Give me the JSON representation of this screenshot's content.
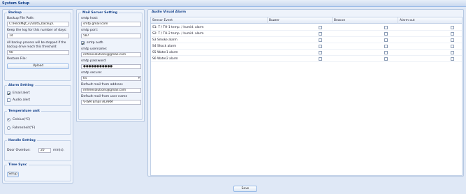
{
  "window": {
    "title": "System Setup"
  },
  "backup": {
    "legend": "Backup",
    "file_path_label": "Backup File Path:",
    "file_path_value": "C:\\ReckMgt_v2\\data_backup\\",
    "keep_log_label": "Keep the log for this number of days:",
    "keep_log_value": "14",
    "threshold_note_1": "All backup process will be stopped if the",
    "threshold_note_2": "backup drive reach this threshold:",
    "threshold_value": "90",
    "restore_label": "Restore File:",
    "upload_button": "Upload"
  },
  "alarm_setting": {
    "legend": "Alarm Setting",
    "email_alert": "Email alert",
    "email_alert_checked": true,
    "audio_alert": "Audio alert",
    "audio_alert_checked": false
  },
  "temperature": {
    "legend": "Temperature unit",
    "celsius": "Celsius(℃)",
    "fahrenheit": "Fahrenheit(℉)",
    "selected": "celsius"
  },
  "handle": {
    "legend": "Handle Setting",
    "door_overdue_label": "Door Overdue:",
    "door_overdue_value": "20",
    "door_overdue_unit": "min(s)."
  },
  "time_sync": {
    "legend": "Time Sync",
    "setup_button": "Setup"
  },
  "mail": {
    "legend": "Mail Server Setting",
    "host_label": "smtp host:",
    "host_value": "smtp.gmail.com",
    "port_label": "smtp port:",
    "port_value": "587",
    "auth_label": "smtp auth",
    "auth_checked": true,
    "username_label": "smtp username:",
    "username_value": "imfreesolutions@gmail.com",
    "password_label": "smtp password:",
    "password_value": "●●●●●●●●●●●",
    "secure_label": "smtp secure:",
    "secure_value": "tls",
    "from_address_label": "Default mail from address",
    "from_address_value": "imfreesolutions@gmail.com",
    "from_name_label": "Default mail from user name",
    "from_name_value": "V-ISM Email ALARM"
  },
  "audio_visual": {
    "legend": "Audio Visual Alarm",
    "columns": [
      "Sensor Event",
      "Buzzer",
      "Beacon",
      "Alarm out"
    ],
    "rows": [
      {
        "event": "S1: T / TH-1 temp. / humid. alarm",
        "buzzer": false,
        "beacon": false,
        "alarm_out": false
      },
      {
        "event": "S2: T / TH-2 temp. / humid. alarm",
        "buzzer": false,
        "beacon": false,
        "alarm_out": false
      },
      {
        "event": "S3 Smoke alarm",
        "buzzer": false,
        "beacon": false,
        "alarm_out": false
      },
      {
        "event": "S4 Shock alarm",
        "buzzer": false,
        "beacon": false,
        "alarm_out": false
      },
      {
        "event": "S5 Water1 alarm",
        "buzzer": false,
        "beacon": false,
        "alarm_out": false
      },
      {
        "event": "S6 Water2 alarm",
        "buzzer": false,
        "beacon": false,
        "alarm_out": false
      }
    ]
  },
  "footer": {
    "save_button": "Save"
  }
}
